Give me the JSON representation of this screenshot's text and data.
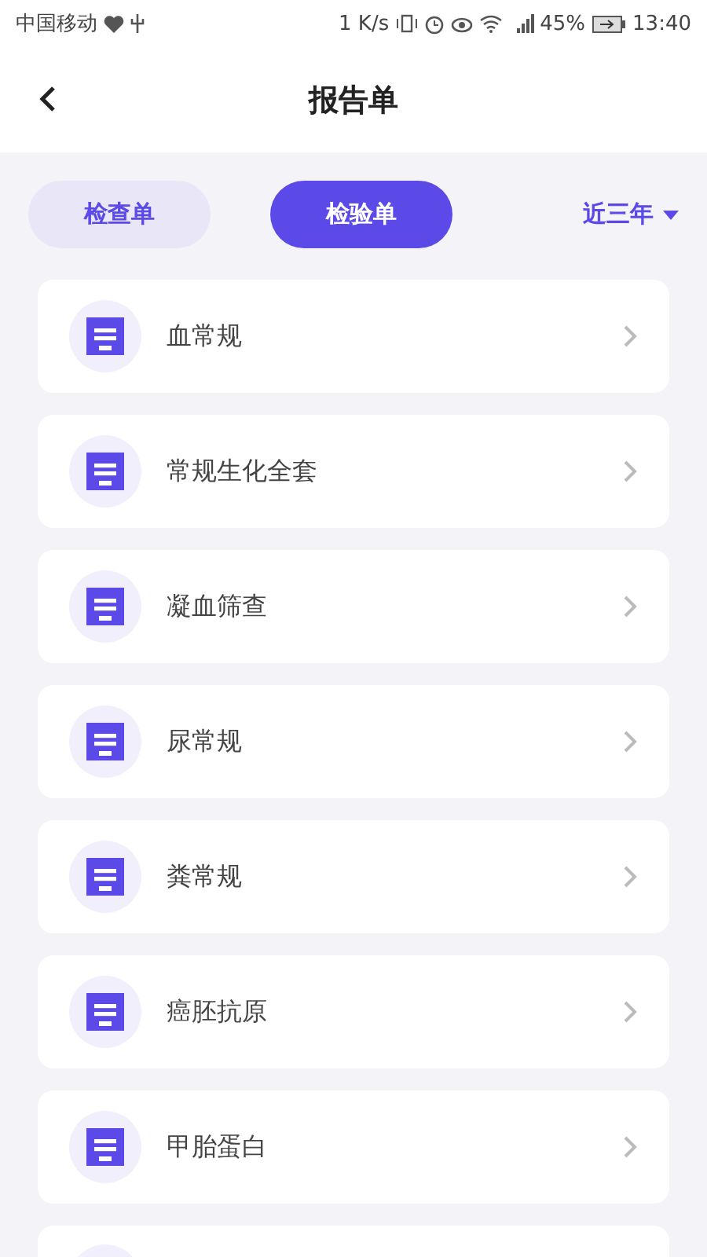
{
  "status_bar": {
    "carrier": "中国移动",
    "speed": "1 K/s",
    "battery": "45%",
    "time": "13:40"
  },
  "header": {
    "title": "报告单"
  },
  "tabs": [
    {
      "label": "检查单",
      "selected": false
    },
    {
      "label": "检验单",
      "selected": true
    }
  ],
  "filter": {
    "label": "近三年"
  },
  "reports": [
    {
      "title": "血常规"
    },
    {
      "title": "常规生化全套"
    },
    {
      "title": "凝血筛查"
    },
    {
      "title": "尿常规"
    },
    {
      "title": "粪常规"
    },
    {
      "title": "癌胚抗原"
    },
    {
      "title": "甲胎蛋白"
    }
  ],
  "more_rows_below": true
}
